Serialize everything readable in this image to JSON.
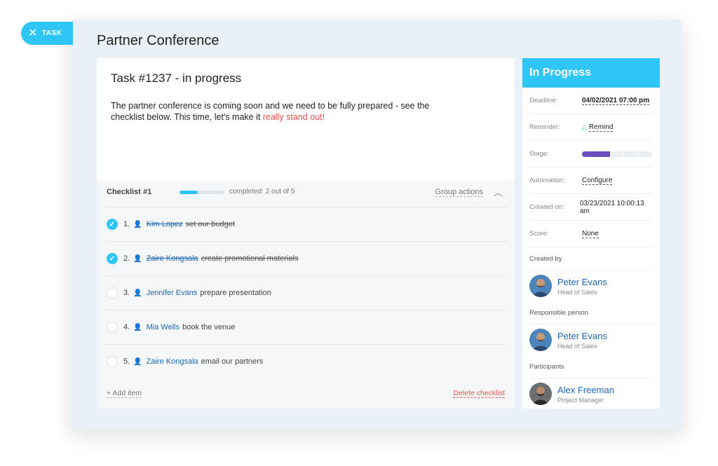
{
  "close_button": {
    "label": "TASK"
  },
  "window_title": "Partner Conference",
  "task": {
    "heading": "Task #1237 - in progress",
    "description_start": "The partner conference is coming soon and we need to be fully prepared - see the checklist below. This time, let's make it ",
    "description_highlight": "really stand out!"
  },
  "checklist": {
    "title": "Checklist #1",
    "progress": 0.4,
    "completed_text": "completed: 2 out of 5",
    "group_actions_label": "Group actions",
    "items": [
      {
        "number": "1.",
        "person": "Kim Lopez",
        "text": "set our budget",
        "done": true
      },
      {
        "number": "2.",
        "person": "Zaire Kongsala",
        "text": "create promotional materials",
        "done": true
      },
      {
        "number": "3.",
        "person": "Jennifer Evans",
        "text": "prepare presentation",
        "done": false
      },
      {
        "number": "4.",
        "person": "Mia Wells",
        "text": "book the venue",
        "done": false
      },
      {
        "number": "5.",
        "person": "Zaire Kongsala",
        "text": "email our partners",
        "done": false
      }
    ],
    "add_item_label": "+ Add item",
    "delete_label": "Delete checklist"
  },
  "sidebar": {
    "status": "In Progress",
    "fields": {
      "deadline_label": "Deadline:",
      "deadline_value": "04/02/2021 07:00 pm",
      "reminder_label": "Reminder:",
      "reminder_value": "Remind",
      "stage_label": "Stage:",
      "stage_progress": 0.4,
      "automation_label": "Automation:",
      "automation_value": "Configure",
      "created_on_label": "Created on:",
      "created_on_value": "03/23/2021 10:00:13 am",
      "score_label": "Score:",
      "score_value": "None"
    },
    "created_by": {
      "label": "Created by",
      "name": "Peter Evans",
      "role": "Head of Sales"
    },
    "responsible": {
      "label": "Responsible person",
      "name": "Peter Evans",
      "role": "Head of Sales"
    },
    "participants": {
      "label": "Participants",
      "name": "Alex Freeman",
      "role": "Project Manager"
    }
  },
  "colors": {
    "accent": "#2fc6f6",
    "link": "#2066b0",
    "danger": "#e6524c",
    "stage": "#6a4ec1"
  }
}
